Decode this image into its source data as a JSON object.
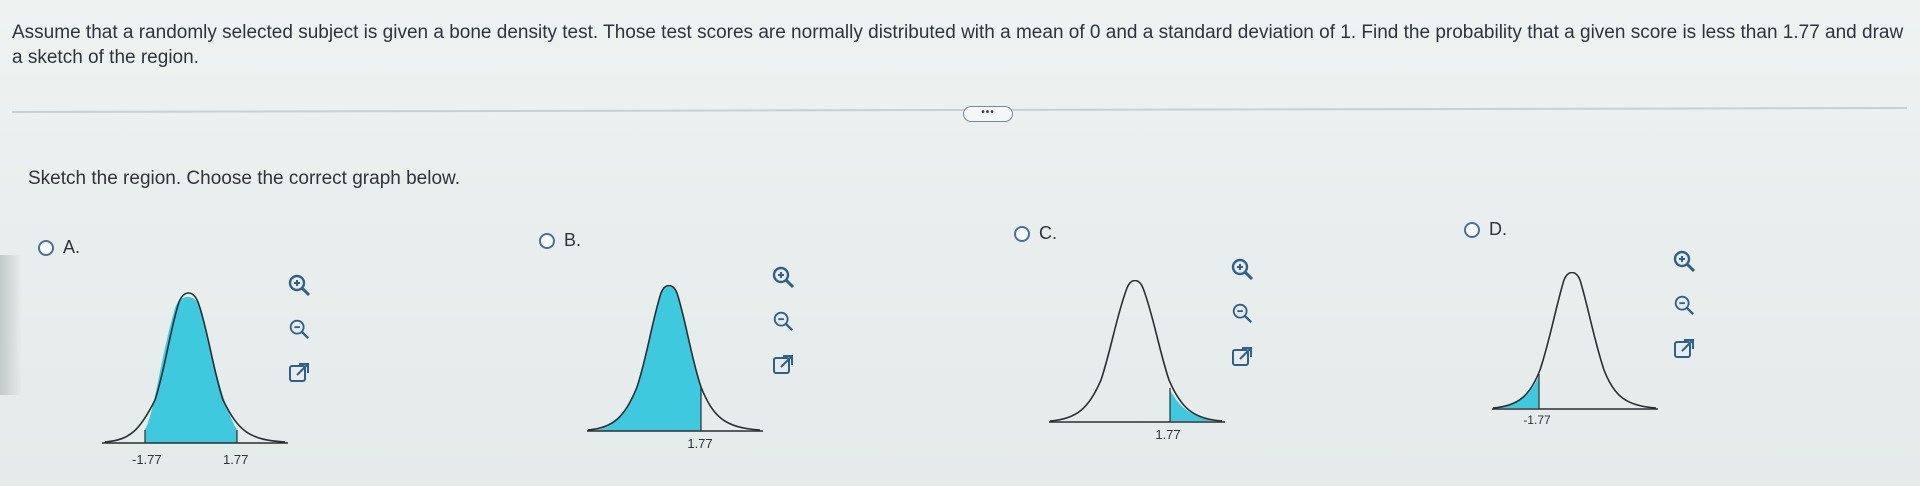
{
  "question": {
    "text": "Assume that a randomly selected subject is given a bone density test. Those test scores are normally distributed with a mean of 0 and a standard deviation of 1. Find the probability that a given score is less than 1.77 and draw a sketch of the region."
  },
  "more_button": {
    "label": "•••"
  },
  "instruction": "Sketch the region. Choose the correct graph below.",
  "options": [
    {
      "letter": "A.",
      "labels": [
        "-1.77",
        "1.77"
      ]
    },
    {
      "letter": "B.",
      "labels": [
        "1.77"
      ]
    },
    {
      "letter": "C.",
      "labels": [
        "1.77"
      ]
    },
    {
      "letter": "D.",
      "labels": [
        "-1.77"
      ]
    }
  ],
  "colors": {
    "fill": "#3fc9df",
    "curve": "#2a2f33",
    "radio": "#4a6f98",
    "icon": "#2f5f8a"
  },
  "icons": [
    "zoom-in-icon",
    "zoom-out-icon",
    "popout-icon"
  ]
}
